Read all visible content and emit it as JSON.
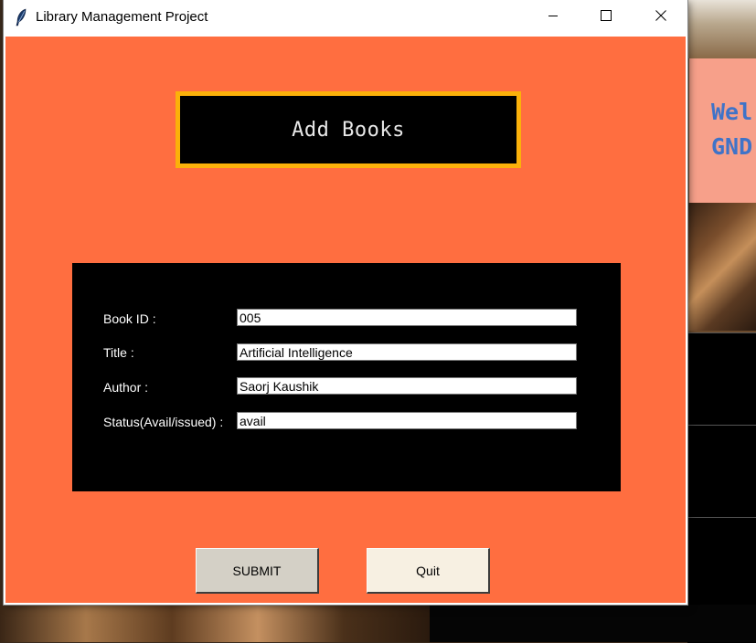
{
  "window": {
    "title": "Library Management Project",
    "icon": "feather-icon",
    "controls": [
      "minimize-icon",
      "maximize-icon",
      "close-icon"
    ]
  },
  "heading": "Add Books",
  "form": {
    "fields": [
      {
        "label": "Book ID :",
        "value": "005"
      },
      {
        "label": "Title :",
        "value": "Artificial Intelligence"
      },
      {
        "label": "Author :",
        "value": "Saorj Kaushik"
      },
      {
        "label": "Status(Avail/issued) :",
        "value": "avail"
      }
    ]
  },
  "buttons": {
    "submit": "SUBMIT",
    "quit": "Quit"
  },
  "background_window": {
    "welcome_line1": "Wel",
    "welcome_line2": "GND"
  },
  "colors": {
    "client_background": "#ff6e40",
    "heading_border": "#fbb10a",
    "heading_background": "#000000",
    "heading_text": "#e8e8e8",
    "form_background": "#000000",
    "submit_button": "#d4d0c6",
    "quit_button": "#f7f0e2",
    "welcome_text": "#3f73c8"
  }
}
